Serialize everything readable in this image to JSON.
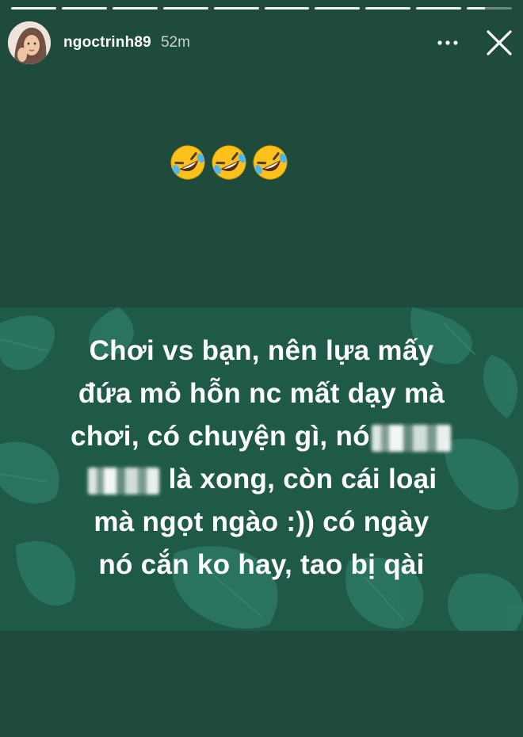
{
  "story": {
    "username": "ngoctrinh89",
    "timestamp": "52m",
    "segments_total": 10,
    "segments_completed": 9,
    "sticker": [
      "rolling-on-floor-laughing-emoji",
      "rolling-on-floor-laughing-emoji",
      "rolling-on-floor-laughing-emoji"
    ],
    "post": {
      "line1": "Chơi vs bạn, nên lựa mấy",
      "line2": "đứa mỏ hỗn nc mất dạy mà",
      "line3a": "chơi, có chuyện gì, nó",
      "line4b": "là xong, còn cái loại",
      "line5": "mà ngọt ngào :)) có ngày",
      "line6": "nó cắn ko hay, tao bị qài"
    }
  },
  "colors": {
    "background": "#1e4b3c",
    "post_background": "#1f5a48",
    "leaf": "#2b7560",
    "text": "#ffffff"
  }
}
